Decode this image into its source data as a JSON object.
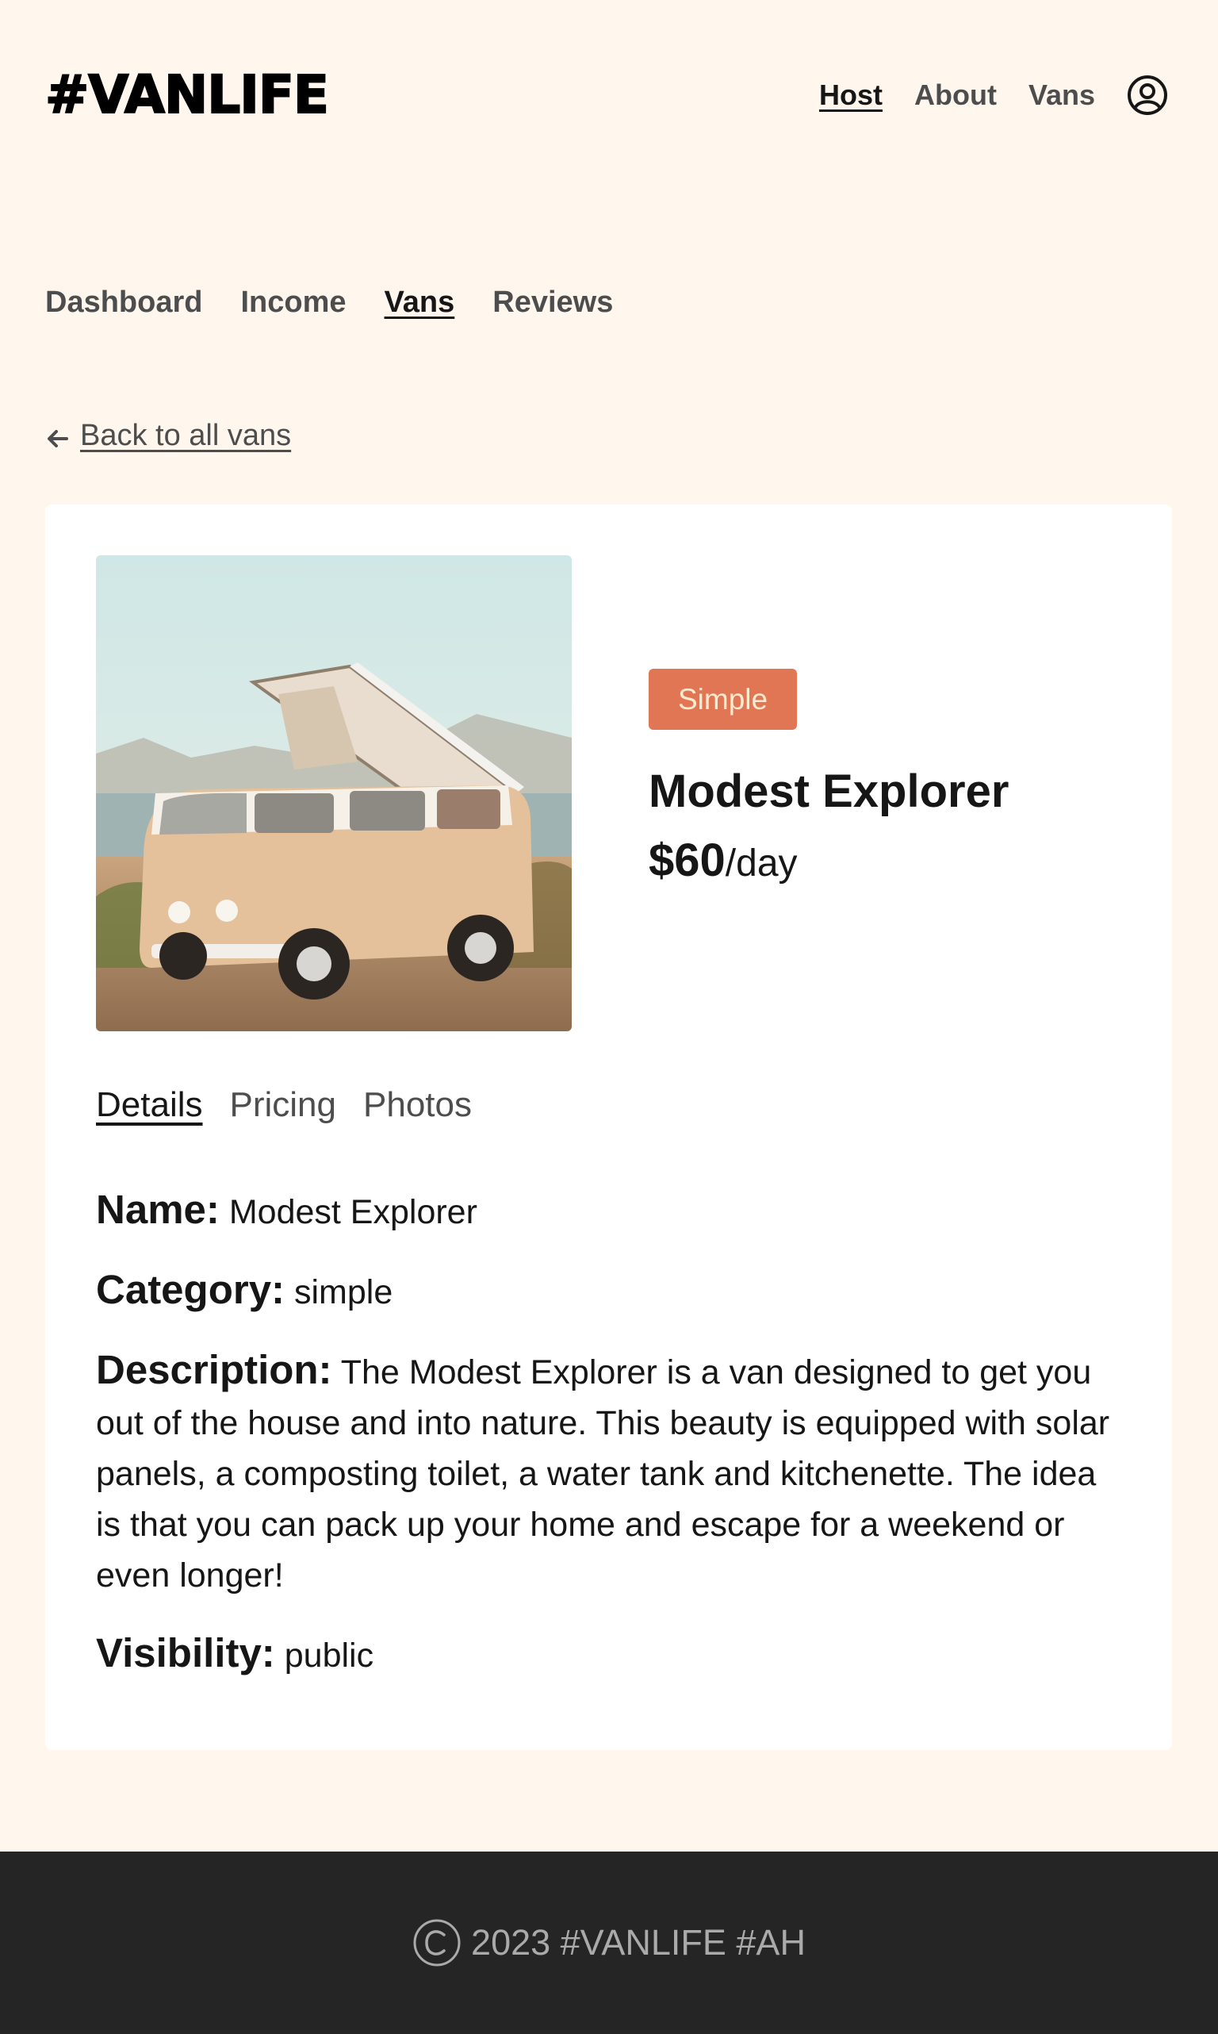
{
  "header": {
    "logo": "#VANLIFE",
    "nav": [
      {
        "label": "Host",
        "active": true
      },
      {
        "label": "About",
        "active": false
      },
      {
        "label": "Vans",
        "active": false
      }
    ],
    "avatar_icon": "user-circle-icon"
  },
  "host_nav": [
    {
      "label": "Dashboard",
      "active": false
    },
    {
      "label": "Income",
      "active": false
    },
    {
      "label": "Vans",
      "active": true
    },
    {
      "label": "Reviews",
      "active": false
    }
  ],
  "back_link": {
    "icon": "arrow-left-icon",
    "label": "Back to all vans"
  },
  "van": {
    "image_icon": "van-photo",
    "badge": "Simple",
    "badge_color": "#E17654",
    "name": "Modest Explorer",
    "price": "$60",
    "price_unit": "/day"
  },
  "tabs": [
    {
      "label": "Details",
      "active": true
    },
    {
      "label": "Pricing",
      "active": false
    },
    {
      "label": "Photos",
      "active": false
    }
  ],
  "details": {
    "name_label": "Name:",
    "name_value": "Modest Explorer",
    "category_label": "Category:",
    "category_value": "simple",
    "description_label": "Description:",
    "description_value": "The Modest Explorer is a van designed to get you out of the house and into nature. This beauty is equipped with solar panels, a composting toilet, a water tank and kitchenette. The idea is that you can pack up your home and escape for a weekend or even longer!",
    "visibility_label": "Visibility:",
    "visibility_value": "public"
  },
  "footer": {
    "icon": "copyright-icon",
    "text": "2023 #VANLIFE #AH"
  },
  "colors": {
    "background": "#FFF7ED",
    "card": "#FFFFFF",
    "footer": "#252525",
    "accent": "#E17654"
  }
}
